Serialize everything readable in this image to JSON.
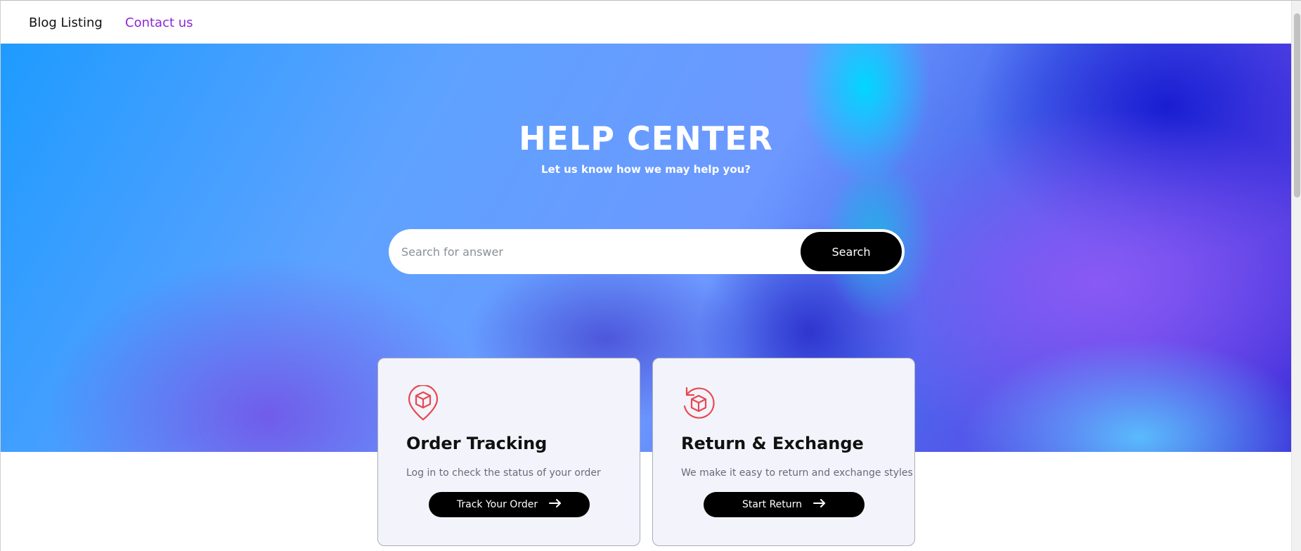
{
  "nav": {
    "blog_label": "Blog Listing",
    "contact_label": "Contact us"
  },
  "hero": {
    "title": "HELP CENTER",
    "subtitle": "Let us know how we may help you?"
  },
  "search": {
    "placeholder": "Search for answer",
    "value": "",
    "button_label": "Search"
  },
  "cards": [
    {
      "icon": "location-box-icon",
      "title": "Order Tracking",
      "description": "Log in to check the status of your order",
      "button_label": "Track Your Order",
      "button_icon": "arrow-right-icon"
    },
    {
      "icon": "return-box-icon",
      "title": "Return & Exchange",
      "description": "We make it easy to return and exchange styles",
      "button_label": "Start Return",
      "button_icon": "arrow-right-icon"
    }
  ],
  "colors": {
    "accent_icon": "#e8484f",
    "contact_link": "#8b27d6",
    "button_bg": "#000000",
    "card_bg": "#f3f4fb"
  }
}
